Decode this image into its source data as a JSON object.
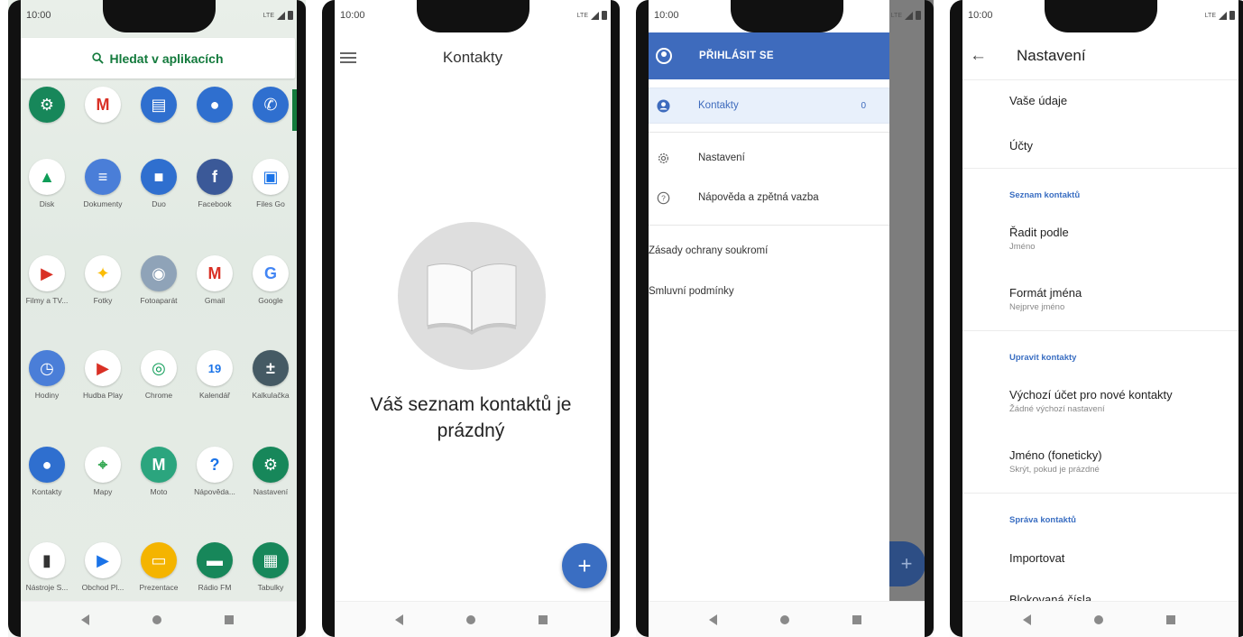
{
  "status_time": "10:00",
  "status_net": "LTE",
  "drawer_screen": {
    "search_label": "Hledat v aplikacích",
    "apps": [
      {
        "label": "",
        "icon": "settings-icon",
        "color": "#17875a"
      },
      {
        "label": "",
        "icon": "gmail-icon",
        "color": "#ffffff"
      },
      {
        "label": "",
        "icon": "messages-icon",
        "color": "#2f6fcf"
      },
      {
        "label": "",
        "icon": "contacts-icon",
        "color": "#2f6fcf"
      },
      {
        "label": "",
        "icon": "phone-icon",
        "color": "#2f6fcf"
      },
      {
        "label": "Disk",
        "icon": "drive-icon",
        "color": "#ffffff"
      },
      {
        "label": "Dokumenty",
        "icon": "docs-icon",
        "color": "#4a7ed8"
      },
      {
        "label": "Duo",
        "icon": "duo-icon",
        "color": "#2f6fcf"
      },
      {
        "label": "Facebook",
        "icon": "facebook-icon",
        "color": "#3b5998"
      },
      {
        "label": "Files Go",
        "icon": "files-go-icon",
        "color": "#ffffff"
      },
      {
        "label": "Filmy a TV...",
        "icon": "play-movies-icon",
        "color": "#ffffff"
      },
      {
        "label": "Fotky",
        "icon": "photos-icon",
        "color": "#ffffff"
      },
      {
        "label": "Fotoaparát",
        "icon": "camera-icon",
        "color": "#8fa3b8"
      },
      {
        "label": "Gmail",
        "icon": "gmail-icon",
        "color": "#ffffff"
      },
      {
        "label": "Google",
        "icon": "google-icon",
        "color": "#ffffff"
      },
      {
        "label": "Hodiny",
        "icon": "clock-icon",
        "color": "#4a7ed8"
      },
      {
        "label": "Hudba Play",
        "icon": "play-music-icon",
        "color": "#ffffff"
      },
      {
        "label": "Chrome",
        "icon": "chrome-icon",
        "color": "#ffffff"
      },
      {
        "label": "Kalendář",
        "icon": "calendar-icon",
        "color": "#ffffff"
      },
      {
        "label": "Kalkulačka",
        "icon": "calculator-icon",
        "color": "#455a64"
      },
      {
        "label": "Kontakty",
        "icon": "contacts-icon",
        "color": "#2f6fcf"
      },
      {
        "label": "Mapy",
        "icon": "maps-icon",
        "color": "#ffffff"
      },
      {
        "label": "Moto",
        "icon": "moto-icon",
        "color": "#2ba57e"
      },
      {
        "label": "Nápověda...",
        "icon": "help-icon",
        "color": "#ffffff"
      },
      {
        "label": "Nastavení",
        "icon": "settings-icon",
        "color": "#17875a"
      },
      {
        "label": "Nástroje S...",
        "icon": "sim-icon",
        "color": "#ffffff"
      },
      {
        "label": "Obchod Pl...",
        "icon": "play-store-icon",
        "color": "#ffffff"
      },
      {
        "label": "Prezentace",
        "icon": "slides-icon",
        "color": "#f4b400"
      },
      {
        "label": "Rádio FM",
        "icon": "radio-icon",
        "color": "#17875a"
      },
      {
        "label": "Tabulky",
        "icon": "sheets-icon",
        "color": "#17875a"
      }
    ]
  },
  "contacts_screen": {
    "title": "Kontakty",
    "empty_line1": "Váš seznam kontaktů je",
    "empty_line2": "prázdný",
    "fab": "+"
  },
  "nav_drawer": {
    "sign_in": "PŘIHLÁSIT SE",
    "contacts_label": "Kontakty",
    "contacts_count": "0",
    "settings_label": "Nastavení",
    "help_label": "Nápověda a zpětná vazba",
    "privacy_label": "Zásady ochrany soukromí",
    "terms_label": "Smluvní podmínky"
  },
  "settings_screen": {
    "title": "Nastavení",
    "your_info": "Vaše údaje",
    "accounts": "Účty",
    "section_list": "Seznam kontaktů",
    "sort_title": "Řadit podle",
    "sort_value": "Jméno",
    "name_format_title": "Formát jména",
    "name_format_value": "Nejprve jméno",
    "section_edit": "Upravit kontakty",
    "default_account_title": "Výchozí účet pro nové kontakty",
    "default_account_value": "Žádné výchozí nastavení",
    "phonetic_title": "Jméno (foneticky)",
    "phonetic_value": "Skrýt, pokud je prázdné",
    "section_manage": "Správa kontaktů",
    "import": "Importovat",
    "cut_item": "Blokovaná čísla"
  }
}
